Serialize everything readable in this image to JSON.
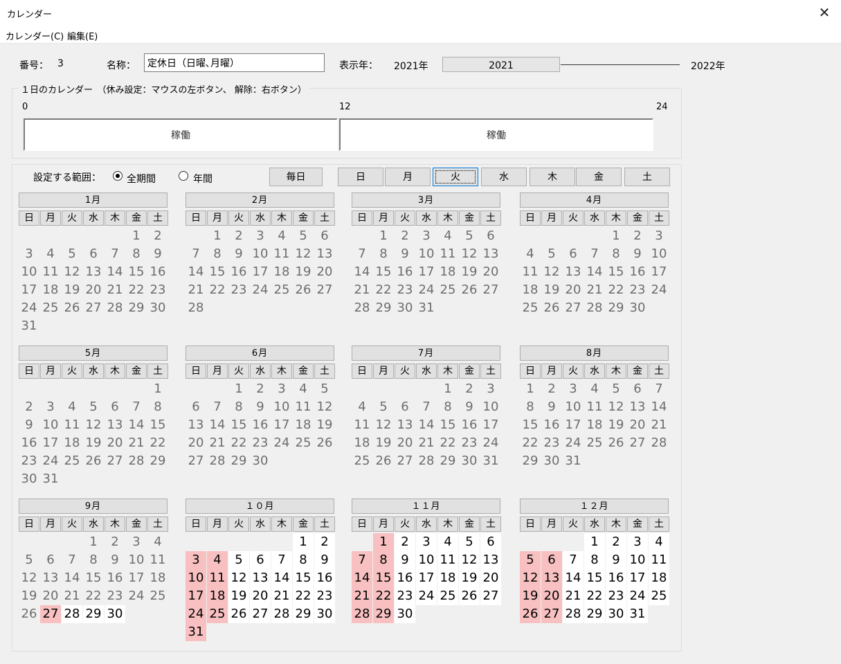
{
  "window": {
    "title": "カレンダー",
    "close": "✕"
  },
  "menu": [
    "カレンダー(C)",
    "編集(E)"
  ],
  "header": {
    "number_label": "番号：",
    "number_value": "3",
    "name_label": "名称：",
    "name_value": "定休日（日曜､月曜）",
    "year_label": "表示年：",
    "year_min": "2021年",
    "year_current": "2021",
    "year_max": "2022年"
  },
  "day_calendar": {
    "legend": "１日のカレンダー　（休み設定：マウスの左ボタン、 解除：右ボタン）",
    "tick_0": "0",
    "tick_12": "12",
    "tick_24": "24",
    "am_status": "稼働",
    "pm_status": "稼働"
  },
  "range": {
    "label": "設定する範囲：",
    "option_all": "全期間",
    "option_year": "年間",
    "selected": "全期間"
  },
  "buttons": {
    "everyday": "毎日",
    "weekdays": [
      "日",
      "月",
      "火",
      "水",
      "木",
      "金",
      "土"
    ],
    "focused_weekday": "火"
  },
  "colors": {
    "holiday": "#f8c0c0",
    "active": "#ffffff",
    "past_text": "#6d6d6d"
  },
  "weekday_headers": [
    "日",
    "月",
    "火",
    "水",
    "木",
    "金",
    "土"
  ],
  "months": [
    {
      "name": "1月",
      "first_weekday": 5,
      "days": 31,
      "holidays": [],
      "active_from": null
    },
    {
      "name": "2月",
      "first_weekday": 1,
      "days": 28,
      "holidays": [],
      "active_from": null
    },
    {
      "name": "3月",
      "first_weekday": 1,
      "days": 31,
      "holidays": [],
      "active_from": null
    },
    {
      "name": "4月",
      "first_weekday": 4,
      "days": 30,
      "holidays": [],
      "active_from": null
    },
    {
      "name": "5月",
      "first_weekday": 6,
      "days": 31,
      "holidays": [],
      "active_from": null
    },
    {
      "name": "6月",
      "first_weekday": 2,
      "days": 30,
      "holidays": [],
      "active_from": null
    },
    {
      "name": "7月",
      "first_weekday": 4,
      "days": 31,
      "holidays": [],
      "active_from": null
    },
    {
      "name": "8月",
      "first_weekday": 0,
      "days": 31,
      "holidays": [],
      "active_from": null
    },
    {
      "name": "9月",
      "first_weekday": 3,
      "days": 30,
      "holidays": [
        27
      ],
      "active_from": 27
    },
    {
      "name": "１０月",
      "first_weekday": 5,
      "days": 31,
      "holidays": [
        3,
        4,
        10,
        11,
        17,
        18,
        24,
        25,
        31
      ],
      "active_from": 1
    },
    {
      "name": "１１月",
      "first_weekday": 1,
      "days": 30,
      "holidays": [
        1,
        7,
        8,
        14,
        15,
        21,
        22,
        28,
        29
      ],
      "active_from": 1
    },
    {
      "name": "１２月",
      "first_weekday": 3,
      "days": 31,
      "holidays": [
        5,
        6,
        12,
        13,
        19,
        20,
        26,
        27
      ],
      "active_from": 1
    }
  ]
}
